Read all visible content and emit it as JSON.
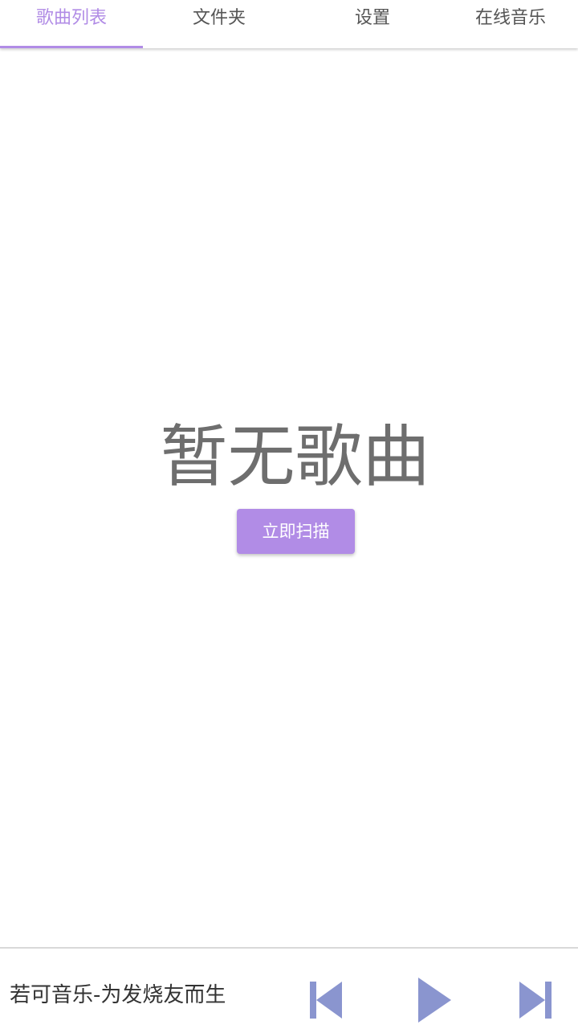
{
  "tabs": [
    {
      "label": "歌曲列表",
      "active": true
    },
    {
      "label": "文件夹",
      "active": false
    },
    {
      "label": "设置",
      "active": false
    },
    {
      "label": "在线音乐",
      "active": false
    }
  ],
  "empty_state": {
    "title": "暂无歌曲",
    "scan_button_label": "立即扫描"
  },
  "player": {
    "title": "若可音乐-为发烧友而生",
    "controls": [
      "skip-previous-icon",
      "play-icon",
      "skip-next-icon"
    ]
  },
  "colors": {
    "accent": "#b18ce6",
    "control": "#8a95cf",
    "empty_text": "#6e6e6e"
  }
}
